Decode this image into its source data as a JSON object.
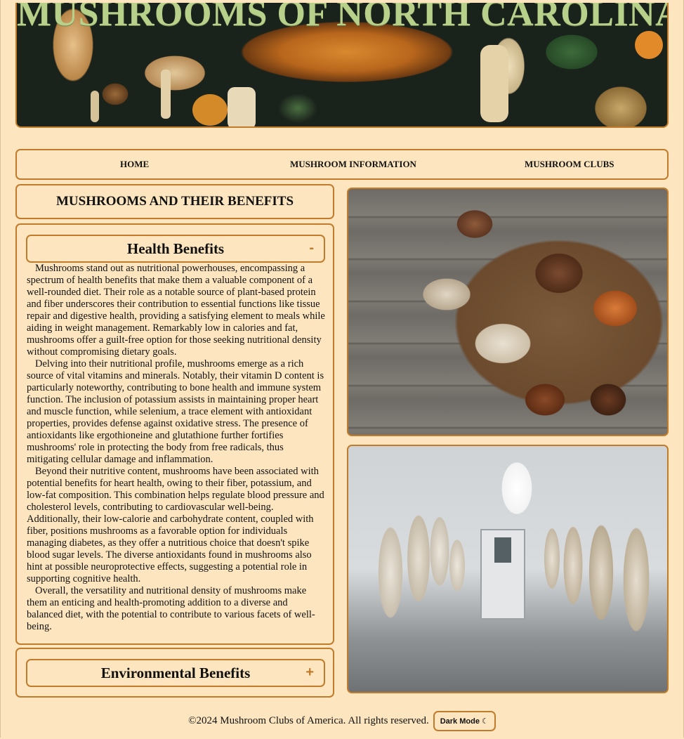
{
  "banner": {
    "title": "MUSHROOMS OF NORTH CAROLINA"
  },
  "nav": {
    "items": [
      {
        "label": "HOME"
      },
      {
        "label": "MUSHROOM INFORMATION"
      },
      {
        "label": "MUSHROOM CLUBS"
      }
    ]
  },
  "main": {
    "section_title": "MUSHROOMS AND THEIR BENEFITS",
    "health": {
      "title": "Health Benefits",
      "toggle": "-",
      "paragraphs": [
        "Mushrooms stand out as nutritional powerhouses, encompassing a spectrum of health benefits that make them a valuable component of a well-rounded diet. Their role as a notable source of plant-based protein and fiber underscores their contribution to essential functions like tissue repair and digestive health, providing a satisfying element to meals while aiding in weight management. Remarkably low in calories and fat, mushrooms offer a guilt-free option for those seeking nutritional density without compromising dietary goals.",
        "Delving into their nutritional profile, mushrooms emerge as a rich source of vital vitamins and minerals. Notably, their vitamin D content is particularly noteworthy, contributing to bone health and immune system function. The inclusion of potassium assists in maintaining proper heart and muscle function, while selenium, a trace element with antioxidant properties, provides defense against oxidative stress. The presence of antioxidants like ergothioneine and glutathione further fortifies mushrooms' role in protecting the body from free radicals, thus mitigating cellular damage and inflammation.",
        "Beyond their nutritive content, mushrooms have been associated with potential benefits for heart health, owing to their fiber, potassium, and low-fat composition. This combination helps regulate blood pressure and cholesterol levels, contributing to cardiovascular well-being. Additionally, their low-calorie and carbohydrate content, coupled with fiber, positions mushrooms as a favorable option for individuals managing diabetes, as they offer a nutritious choice that doesn't spike blood sugar levels. The diverse antioxidants found in mushrooms also hint at possible neuroprotective effects, suggesting a potential role in supporting cognitive health.",
        "Overall, the versatility and nutritional density of mushrooms make them an enticing and health-promoting addition to a diverse and balanced diet, with the potential to contribute to various facets of well-being."
      ]
    },
    "environmental": {
      "title": "Environmental Benefits",
      "toggle": "+"
    }
  },
  "footer": {
    "copyright": "©2024 Mushroom Clubs of America. All rights reserved.",
    "mode_button": "Dark Mode ☾"
  },
  "colors": {
    "background": "#fde6bf",
    "accent": "#c17b2a",
    "title_green": "#b7d18a"
  }
}
